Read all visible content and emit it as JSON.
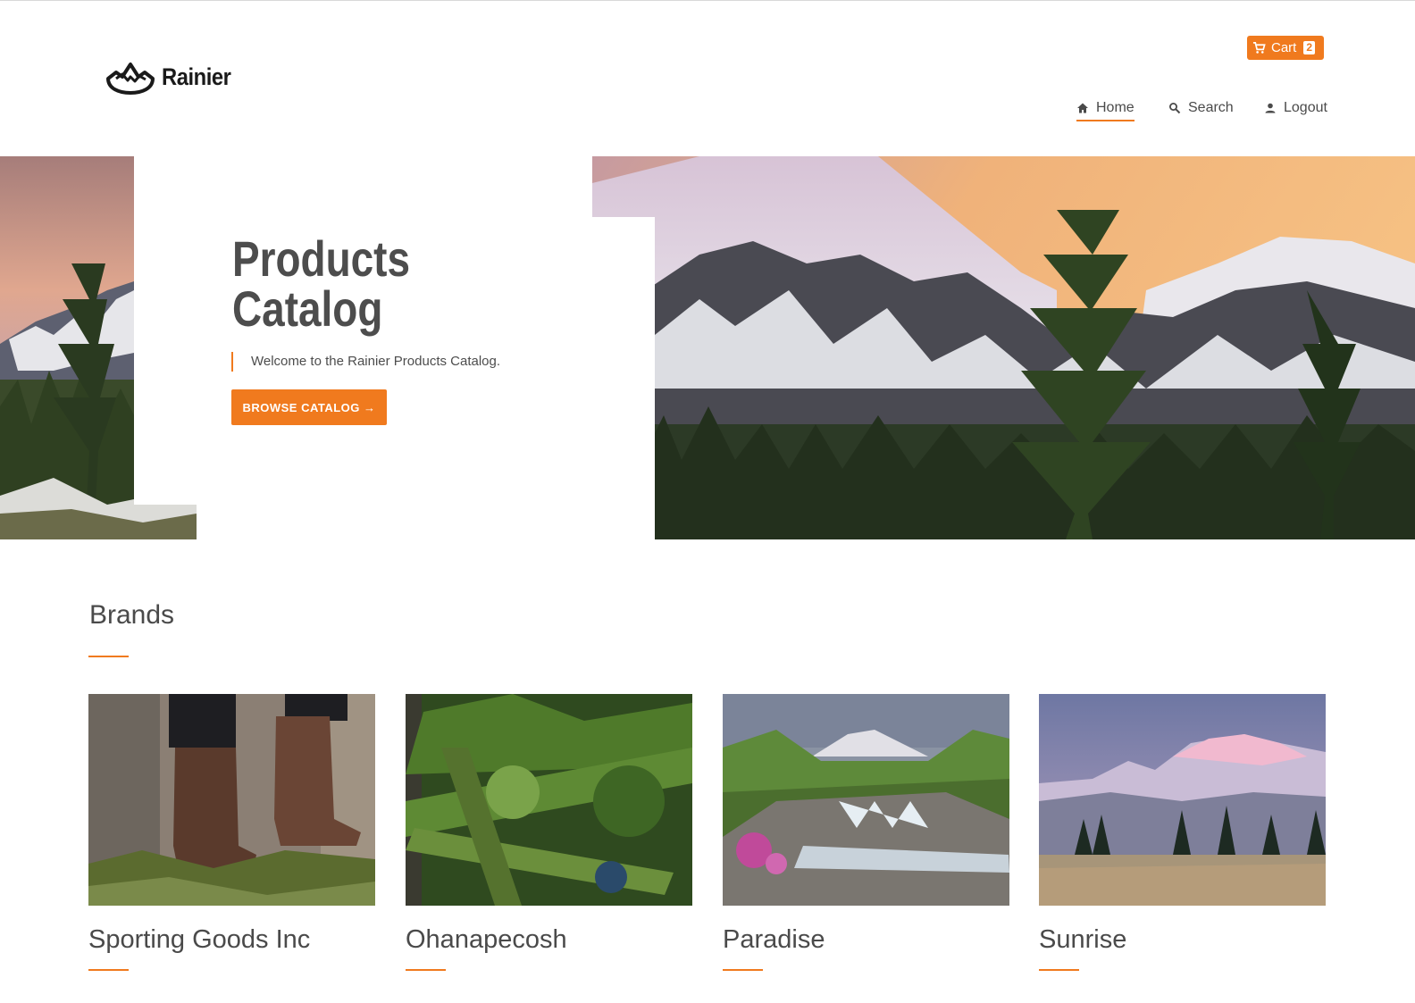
{
  "header": {
    "logo_text": "Rainier",
    "cart": {
      "label": "Cart",
      "count": "2"
    },
    "nav": [
      {
        "label": "Home",
        "icon": "home-icon",
        "active": true
      },
      {
        "label": "Search",
        "icon": "search-icon",
        "active": false
      },
      {
        "label": "Logout",
        "icon": "user-icon",
        "active": false
      }
    ]
  },
  "hero": {
    "title_line1": "Products",
    "title_line2": "Catalog",
    "subtitle": "Welcome to the Rainier Products Catalog.",
    "cta_label": "BROWSE CATALOG →"
  },
  "brands": {
    "title": "Brands",
    "items": [
      {
        "name": "Sporting Goods Inc",
        "image": "hiking-boots-photo"
      },
      {
        "name": "Ohanapecosh",
        "image": "mossy-forest-photo"
      },
      {
        "name": "Paradise",
        "image": "mountain-stream-photo"
      },
      {
        "name": "Sunrise",
        "image": "sunrise-mountain-photo"
      }
    ]
  },
  "colors": {
    "accent": "#f07a1e",
    "text": "#4d4d4d"
  }
}
